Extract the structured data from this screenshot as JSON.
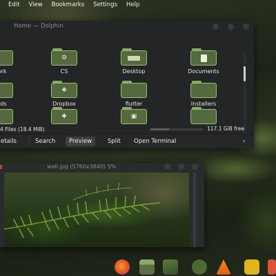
{
  "menubar": [
    "Edit",
    "View",
    "Bookmarks",
    "Settings",
    "Help"
  ],
  "dolphin": {
    "title": "Home — Dolphin",
    "files": [
      {
        "label": "work",
        "emblem": "none"
      },
      {
        "label": "CS",
        "emblem": "gear"
      },
      {
        "label": "Desktop",
        "emblem": "bar"
      },
      {
        "label": "Documents",
        "emblem": "doc"
      },
      {
        "label": "oads",
        "emblem": "none"
      },
      {
        "label": "Dropbox",
        "emblem": "dropbox"
      },
      {
        "label": "flutter",
        "emblem": "none"
      },
      {
        "label": "Installers",
        "emblem": "none"
      },
      {
        "label": "",
        "emblem": "none"
      },
      {
        "label": "",
        "emblem": "gamepad"
      },
      {
        "label": "",
        "emblem": "image"
      },
      {
        "label": "",
        "emblem": "none"
      }
    ],
    "status_left": "4 Files (18.4 MiB)",
    "status_right": "117.1 GiB free",
    "free_space_fill": 0.35,
    "tabs": {
      "details": "etails",
      "search": "Search",
      "preview": "Preview",
      "split": "Split",
      "open_terminal": "Open Terminal",
      "more": "›"
    }
  },
  "viewer": {
    "title": "wall.jpg (5760x3840) 5%"
  },
  "dock": [
    "firefox-icon",
    "files-icon",
    "image-viewer-icon",
    "settings-icon",
    "vlc-icon",
    "media-player-icon",
    "extra-icon"
  ]
}
